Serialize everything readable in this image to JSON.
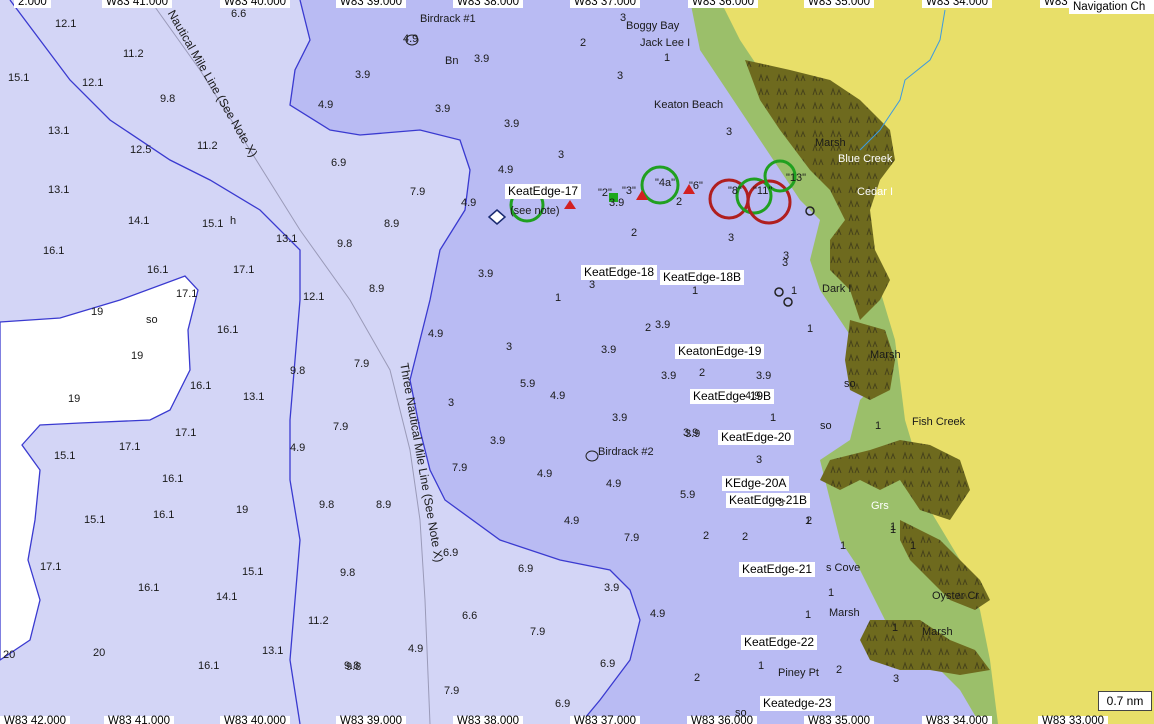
{
  "top_ruler": [
    "2.000",
    "W83 41.000",
    "W83 40.000",
    "W83 39.000",
    "W83 38.000",
    "W83 37.000",
    "W83 36.000",
    "W83 35.000",
    "W83 34.000",
    "W83"
  ],
  "bottom_ruler": [
    "W83 42.000",
    "W83 41.000",
    "W83 40.000",
    "W83 39.000",
    "W83 38.000",
    "W83 37.000",
    "W83 36.000",
    "W83 35.000",
    "W83 34.000",
    "W83 33.000"
  ],
  "nav_tab": "Navigation Ch",
  "scale": "0.7 nm",
  "boundary_labels": [
    "Nautical Mile Line (See Note X)",
    "Three Nautical Mile Line (See Note X)"
  ],
  "place_names": [
    "Birdrack #1",
    "Boggy Bay",
    "Jack Lee I",
    "Keaton Beach",
    "Marsh",
    "Blue Creek",
    "Cedar I",
    "Dark I",
    "Marsh",
    "Fish Creek",
    "Birdrack #2",
    "Grs",
    "s Cove",
    "Marsh",
    "Oyster Cr",
    "Marsh",
    "Piney Pt",
    "(see note)",
    "Bn",
    "h"
  ],
  "waypoints": [
    "KeatEdge-17",
    "KeatEdge-18",
    "KeatEdge-18B",
    "KeatonEdge-19",
    "KeatEdge-19B",
    "KeatEdge-20",
    "KEdge-20A",
    "KeatEdge-21B",
    "KeatEdge-21",
    "KeatEdge-22",
    "Keatedge-23"
  ],
  "buoy_labels": [
    "\"2\"",
    "\"3\"",
    "\"4a\"",
    "\"6\"",
    "\"8\"",
    "\"11\"",
    "\"13\""
  ],
  "soundings": [
    "12.1",
    "6.6",
    "11.2",
    "15.1",
    "12.1",
    "9.8",
    "13.1",
    "12.5",
    "11.2",
    "13.1",
    "14.1",
    "15.1",
    "16.1",
    "16.1",
    "17.1",
    "19",
    "17.1",
    "so",
    "16.1",
    "19",
    "16.1",
    "19",
    "13.1",
    "17.1",
    "15.1",
    "17.1",
    "16.1",
    "15.1",
    "16.1",
    "19",
    "17.1",
    "16.1",
    "14.1",
    "15.1",
    "20",
    "20",
    "16.1",
    "13.1",
    "11.2",
    "9.8",
    "3.9",
    "4.9",
    "3.9",
    "2",
    "3",
    "1",
    "3.9",
    "3.9",
    "6.9",
    "3",
    "4.9",
    "7.9",
    "4.9",
    "8.9",
    "9.8",
    "13.1",
    "12.1",
    "8.9",
    "7.9",
    "3.9",
    "3",
    "3.9",
    "4.9",
    "3",
    "3.9",
    "5.9",
    "4.9",
    "9.8",
    "7.9",
    "3.9",
    "3.9",
    "4.9",
    "8.9",
    "7.9",
    "4.9",
    "4.9",
    "9.8",
    "5.9",
    "4.9",
    "7.9",
    "9.8",
    "6.9",
    "6.9",
    "4.9",
    "3.9",
    "6.6",
    "7.9",
    "6.9",
    "4.9",
    "9.8",
    "7.9",
    "6.9",
    "4.9",
    "3",
    "3",
    "1",
    "2",
    "2",
    "2",
    "3",
    "3",
    "3",
    "1",
    "1",
    "3.9",
    "3.9",
    "4.9",
    "3.9",
    "3.9",
    "2",
    "2",
    "3.9",
    "2",
    "so",
    "2",
    "1",
    "so",
    "so",
    "1",
    "1",
    "1",
    "1",
    "1",
    "2",
    "3",
    "3",
    "1",
    "1",
    "1",
    "3",
    "3",
    "2",
    "1",
    "1",
    "1"
  ]
}
